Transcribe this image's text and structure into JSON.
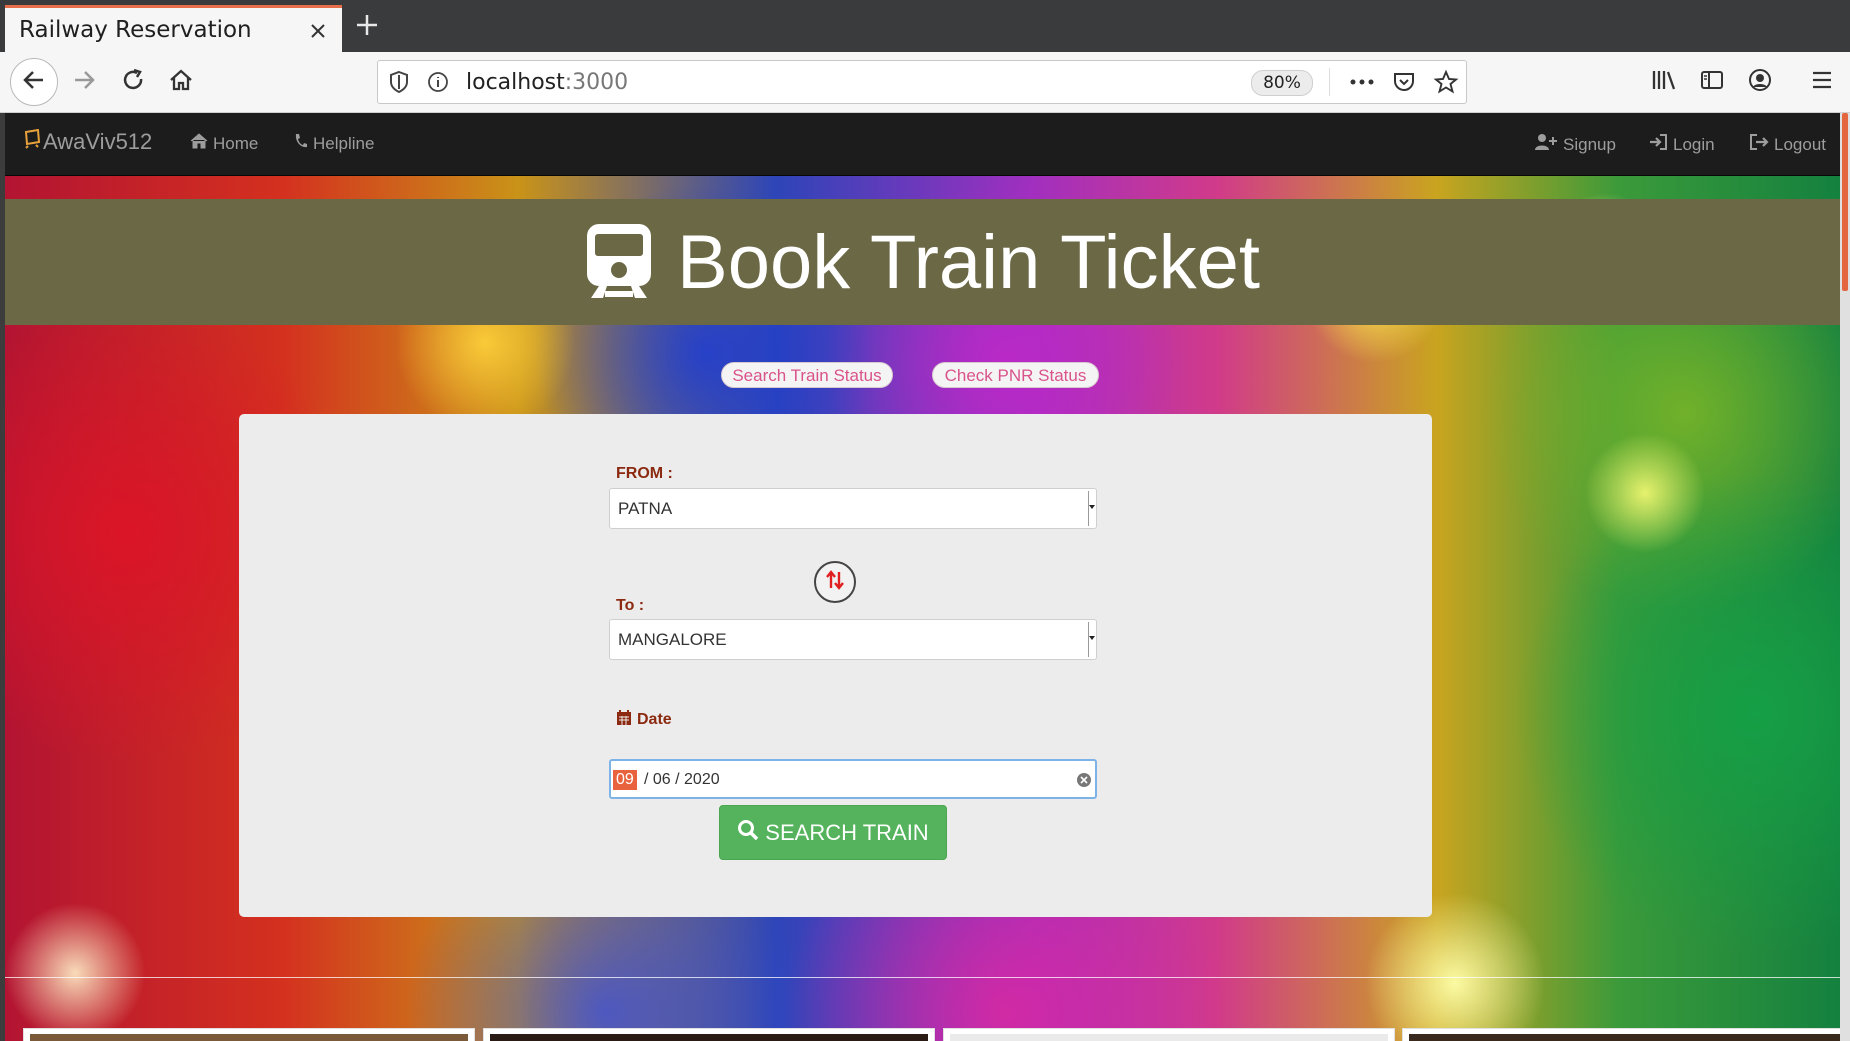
{
  "browser": {
    "tab_title": "Railway Reservation",
    "url_host": "localhost",
    "url_port": ":3000",
    "zoom": "80%"
  },
  "navbar": {
    "brand": "AwaViv512",
    "home": "Home",
    "helpline": "Helpline",
    "signup": "Signup",
    "login": "Login",
    "logout": "Logout"
  },
  "hero": {
    "title": "Book Train Ticket"
  },
  "actions": {
    "search_status": "Search Train Status",
    "pnr_status": "Check PNR Status"
  },
  "form": {
    "from_label": "FROM :",
    "from_value": "PATNA",
    "to_label": "To :",
    "to_value": "MANGALORE",
    "date_label": "Date",
    "date_day": "09",
    "date_rest": "/ 06 / 2020",
    "search_button": "SEARCH TRAIN"
  },
  "colors": {
    "accent": "#e66e4b",
    "hero_bg": "#6b6845",
    "label": "#8b2a10",
    "button": "#54b35c",
    "pill_text": "#d9538b"
  },
  "icons": [
    "close-icon",
    "plus-icon",
    "back-arrow-icon",
    "forward-arrow-icon",
    "reload-icon",
    "home-icon",
    "shield-icon",
    "info-icon",
    "more-dots-icon",
    "pocket-icon",
    "star-icon",
    "library-icon",
    "sidebar-icon",
    "account-icon",
    "menu-icon",
    "train-icon",
    "swap-icon",
    "calendar-icon",
    "search-icon",
    "phone-icon",
    "user-plus-icon",
    "login-icon",
    "logout-icon"
  ]
}
